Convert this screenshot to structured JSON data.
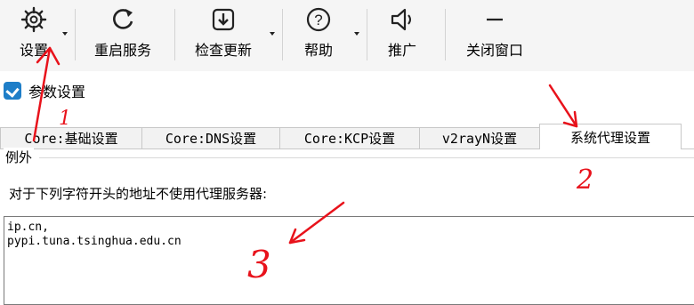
{
  "toolbar": {
    "items": [
      {
        "label": "设置",
        "icon": "gear-icon",
        "has_dropdown": true
      },
      {
        "label": "重启服务",
        "icon": "restart-icon",
        "has_dropdown": false
      },
      {
        "label": "检查更新",
        "icon": "download-icon",
        "has_dropdown": true
      },
      {
        "label": "帮助",
        "icon": "help-icon",
        "has_dropdown": true
      },
      {
        "label": "推广",
        "icon": "speaker-icon",
        "has_dropdown": false
      },
      {
        "label": "关闭窗口",
        "icon": "minimize-icon",
        "has_dropdown": false
      }
    ]
  },
  "window": {
    "title": "参数设置",
    "icon": "v2rayn-logo-icon"
  },
  "tabs": [
    {
      "label": "Core:基础设置",
      "active": false
    },
    {
      "label": "Core:DNS设置",
      "active": false
    },
    {
      "label": "Core:KCP设置",
      "active": false
    },
    {
      "label": "v2rayN设置",
      "active": false
    },
    {
      "label": "系统代理设置",
      "active": true
    }
  ],
  "proxy_settings": {
    "group_label": "例外",
    "description": "对于下列字符开头的地址不使用代理服务器:",
    "exceptions_value": "ip.cn,\npypi.tuna.tsinghua.edu.cn"
  },
  "annotations": {
    "color": "#e8121b",
    "numbers": [
      "1",
      "2",
      "3"
    ]
  },
  "colors": {
    "toolbar_bg": "#f5f5f5",
    "tab_bg": "#f2f2f2",
    "accent": "#1e7ec8",
    "annotation": "#e8121b"
  }
}
